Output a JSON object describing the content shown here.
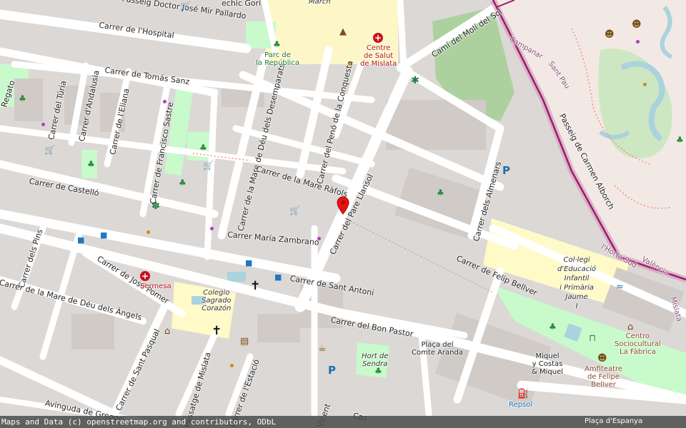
{
  "map": {
    "streets": {
      "passeig_doctor": "Passeig Doctor José Mir Pallardo",
      "hospital": "Carrer de l'Hospital",
      "tomas_sanz": "Carrer de Tomás Sanz",
      "turia": "Carrer del Túria",
      "andalusia": "Carrer d'Andalusia",
      "eliana": "Carrer de l'Eliana",
      "francisco_sastre": "Carrer de Francisco Sastre",
      "castello": "Carrer de Castelló",
      "mare_deu_desemparats": "Carrer de la Mare de Déu dels Desemparats",
      "peno_conquesta": "Carrer del Penó de la Conquesta",
      "mare_rafols": "Carrer de la Mare Ràfols",
      "pare_llansol": "Carrer del Pare Llansol",
      "maria_zambrano": "Carrer María Zambrano",
      "almenars": "Carrer dels Almenars",
      "cami_moli": "Camí del Molí del Sol",
      "pins": "Carrer dels Pins",
      "jose_pomer": "Carrer de José Pomer",
      "mare_deu_angels": "Carrer de la Mare de Déu dels Àngels",
      "sant_antoni": "Carrer de Sant Antoni",
      "bon_pastor": "Carrer del Bon Pastor",
      "felip_bellver": "Carrer de Felip Bellver",
      "sant_pasqual": "Carrer de Sant Pasqual",
      "passatge_mislata": "Passatge de Mislata",
      "estacio": "Carrer de l'Estació",
      "avinguda": "Avinguda de Gregori",
      "passeig_carmen": "Passeig de Carmen Alborch",
      "regato": "Regato",
      "campanar": "Campanar",
      "sant_pau": "Sant Pau",
      "horta_sud": "l'Horta Sud",
      "valencia": "València",
      "mislata": "Mislata",
      "gori": "echic Gori",
      "march": "March",
      "vicent": "Vicent",
      "cas": "Cas"
    },
    "places": {
      "parc_republica": "Parc de\nla República",
      "centre_salut": "Centre\nde Salut\nde Mislata",
      "sermesa": "Sermesa",
      "colegio": "Colegio\nSagrado\nCorazón",
      "placa_comte": "Plaça del\nComte Aranda",
      "hort_sendra": "Hort de\nSendra",
      "miquel_costas": "Miquel\ny Costas\n& Miquel",
      "col_legi": "Col·legi\nd'Educació\nInfantil\ni Primària\nJaume\nI",
      "centro_socio": "Centro\nSociocultural\nLa Fàbrica",
      "amfiteatre": "Amfiteatre\nde Felipe\nBellver",
      "repsol": "Repsol",
      "placa_espanya": "Plaça d'Espanya"
    },
    "icons": [
      "hospital-icon",
      "church-icon",
      "tree-icon",
      "parking-icon",
      "shop-icon",
      "bus-stop-icon",
      "pharmacy-icon",
      "theatre-icon",
      "fuel-icon",
      "location-pin-icon"
    ],
    "colors": {
      "background": "#dcd8d5",
      "road": "#ffffff",
      "park": "#c8facc",
      "forest": "#add19e",
      "school": "#fffac8",
      "water": "#aad3df",
      "boundary": "#9e1a6c",
      "pin": "#e8120f"
    },
    "attribution": "Maps and Data (c) openstreetmap.org and contributors, ODbL"
  }
}
